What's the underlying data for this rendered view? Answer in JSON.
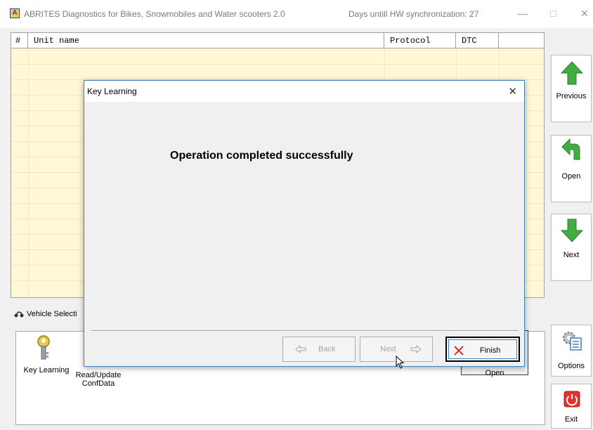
{
  "window": {
    "app_logo": "A",
    "title": "ABRITES Diagnostics for Bikes, Snowmobiles and Water scooters 2.0",
    "sync_status": "Days untill HW synchronization: 27",
    "minimize_glyph": "—",
    "close_glyph": "✕"
  },
  "table": {
    "columns": [
      "#",
      "Unit name",
      "Protocol",
      "DTC"
    ],
    "rows": []
  },
  "side_buttons": {
    "previous": "Previous",
    "open": "Open",
    "next": "Next",
    "options": "Options",
    "exit": "Exit"
  },
  "bottom_panel": {
    "tab_label": "Vehicle Selecti",
    "items": [
      {
        "label": "Key Learning"
      },
      {
        "label_line1": "Read/Update",
        "label_line2": "ConfData"
      }
    ],
    "background_open_label": "Open"
  },
  "dialog": {
    "title": "Key Learning",
    "close_glyph": "✕",
    "message": "Operation completed successfully",
    "back_label": "Back",
    "next_label": "Next",
    "finish_label": "Finish"
  },
  "colors": {
    "table_bg": "#fff8d6",
    "arrow_green": "#3fae3f",
    "dialog_border": "#3d85c6",
    "finish_x": "#e03030",
    "exit_red": "#e2322a"
  }
}
